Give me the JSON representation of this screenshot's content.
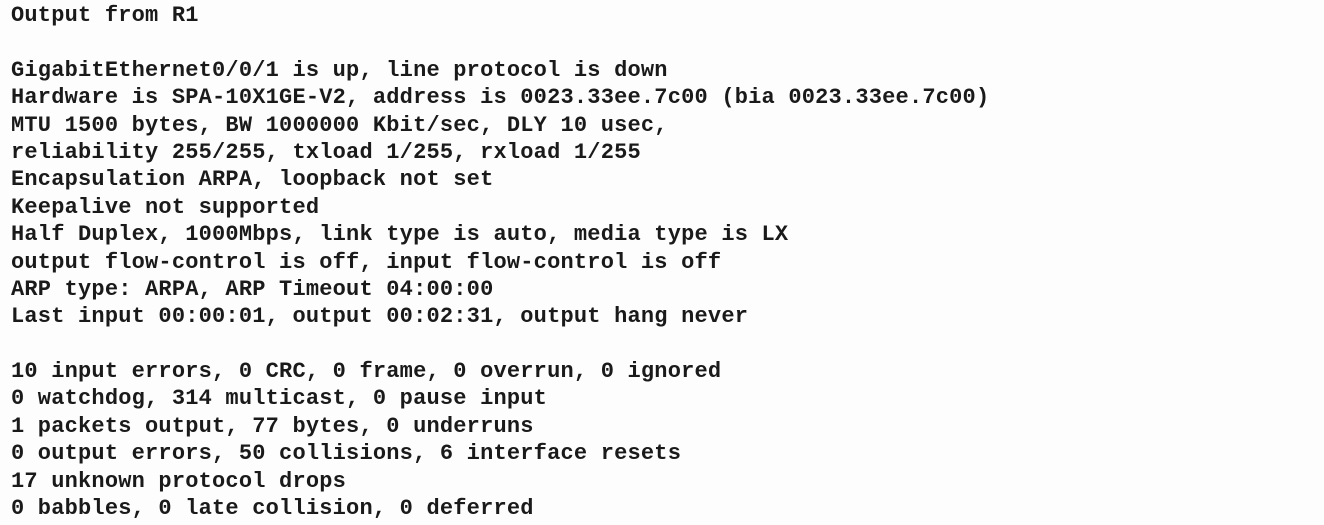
{
  "title": "Output from R1",
  "block1": [
    "GigabitEthernet0/0/1 is up, line protocol is down",
    "Hardware is SPA-10X1GE-V2, address is 0023.33ee.7c00 (bia 0023.33ee.7c00)",
    "MTU 1500 bytes, BW 1000000 Kbit/sec, DLY 10 usec,",
    "reliability 255/255, txload 1/255, rxload 1/255",
    "Encapsulation ARPA, loopback not set",
    "Keepalive not supported",
    "Half Duplex, 1000Mbps, link type is auto, media type is LX",
    "output flow-control is off, input flow-control is off",
    "ARP type: ARPA, ARP Timeout 04:00:00",
    "Last input 00:00:01, output 00:02:31, output hang never"
  ],
  "block2": [
    "10 input errors, 0 CRC, 0 frame, 0 overrun, 0 ignored",
    "0 watchdog, 314 multicast, 0 pause input",
    "1 packets output, 77 bytes, 0 underruns",
    "0 output errors, 50 collisions, 6 interface resets",
    "17 unknown protocol drops",
    "0 babbles, 0 late collision, 0 deferred"
  ]
}
